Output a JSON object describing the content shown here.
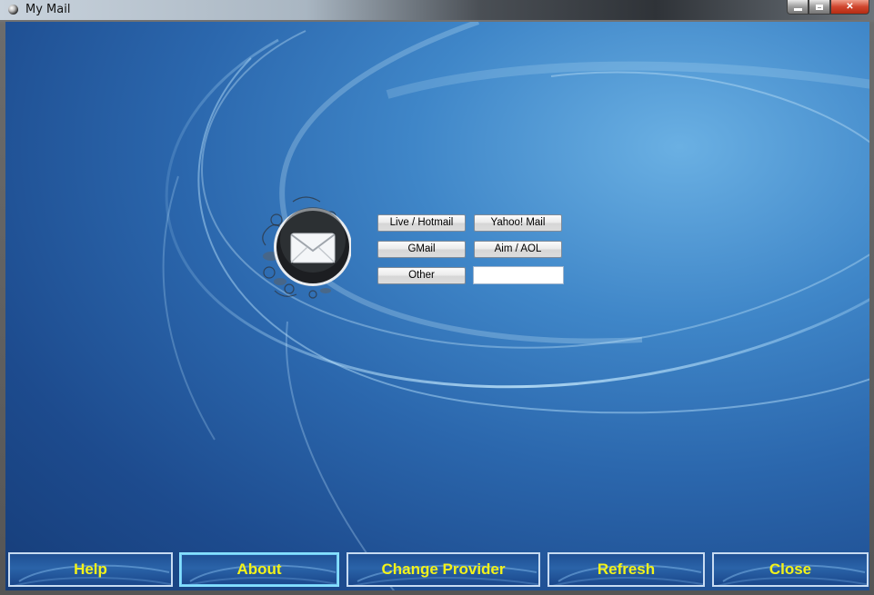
{
  "window": {
    "title": "My Mail"
  },
  "providers": {
    "live_hotmail": "Live / Hotmail",
    "yahoo_mail": "Yahoo! Mail",
    "gmail": "GMail",
    "aim_aol": "Aim / AOL",
    "other": "Other",
    "other_input_value": ""
  },
  "footer": {
    "help": "Help",
    "about": "About",
    "change_provider": "Change Provider",
    "refresh": "Refresh",
    "close": "Close"
  },
  "colors": {
    "background_blue": "#2b67ad",
    "button_text_yellow": "#f2f21a",
    "button_border": "#c7dbf2"
  },
  "icons": {
    "app": "app-icon",
    "logo": "envelope-icon"
  }
}
